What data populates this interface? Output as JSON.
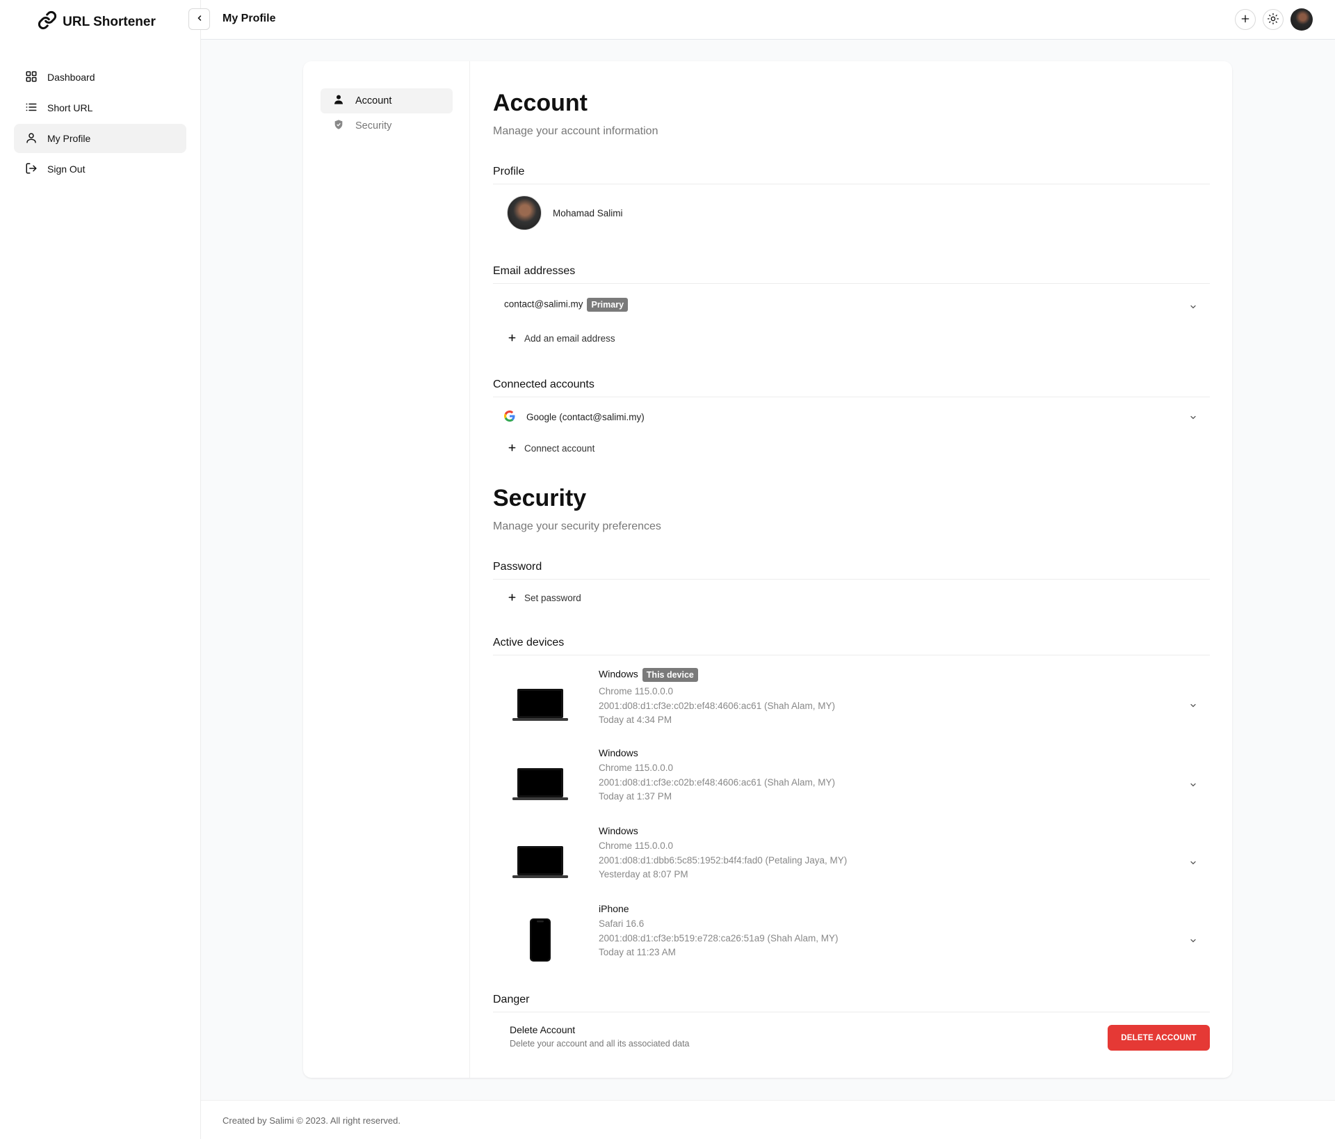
{
  "app": {
    "brand": "URL Shortener",
    "page_title": "My Profile"
  },
  "sidebar": {
    "items": [
      {
        "label": "Dashboard",
        "icon": "dashboard-icon"
      },
      {
        "label": "Short URL",
        "icon": "list-icon"
      },
      {
        "label": "My Profile",
        "icon": "user-icon",
        "active": true
      },
      {
        "label": "Sign Out",
        "icon": "sign-out-icon"
      }
    ]
  },
  "card_nav": {
    "account": "Account",
    "security": "Security"
  },
  "account": {
    "title": "Account",
    "subtitle": "Manage your account information",
    "profile_title": "Profile",
    "profile_name": "Mohamad Salimi",
    "email_title": "Email addresses",
    "email": "contact@salimi.my",
    "email_badge": "Primary",
    "add_email": "Add an email address",
    "connected_title": "Connected accounts",
    "connected_account": "Google (contact@salimi.my)",
    "connect_account": "Connect account"
  },
  "security": {
    "title": "Security",
    "subtitle": "Manage your security preferences",
    "password_title": "Password",
    "set_password": "Set password",
    "devices_title": "Active devices",
    "devices": [
      {
        "name": "Windows",
        "badge": "This device",
        "browser": "Chrome 115.0.0.0",
        "ip": "2001:d08:d1:cf3e:c02b:ef48:4606:ac61 (Shah Alam, MY)",
        "time": "Today at 4:34 PM",
        "type": "laptop"
      },
      {
        "name": "Windows",
        "badge": "",
        "browser": "Chrome 115.0.0.0",
        "ip": "2001:d08:d1:cf3e:c02b:ef48:4606:ac61 (Shah Alam, MY)",
        "time": "Today at 1:37 PM",
        "type": "laptop"
      },
      {
        "name": "Windows",
        "badge": "",
        "browser": "Chrome 115.0.0.0",
        "ip": "2001:d08:d1:dbb6:5c85:1952:b4f4:fad0 (Petaling Jaya, MY)",
        "time": "Yesterday at 8:07 PM",
        "type": "laptop"
      },
      {
        "name": "iPhone",
        "badge": "",
        "browser": "Safari 16.6",
        "ip": "2001:d08:d1:cf3e:b519:e728:ca26:51a9 (Shah Alam, MY)",
        "time": "Today at 11:23 AM",
        "type": "phone"
      }
    ],
    "danger_title": "Danger",
    "delete_title": "Delete Account",
    "delete_desc": "Delete your account and all its associated data",
    "delete_button": "DELETE ACCOUNT"
  },
  "footer": {
    "text": "Created by Salimi © 2023. All right reserved."
  },
  "colors": {
    "danger": "#e53935",
    "badge": "#7a7a7a"
  }
}
